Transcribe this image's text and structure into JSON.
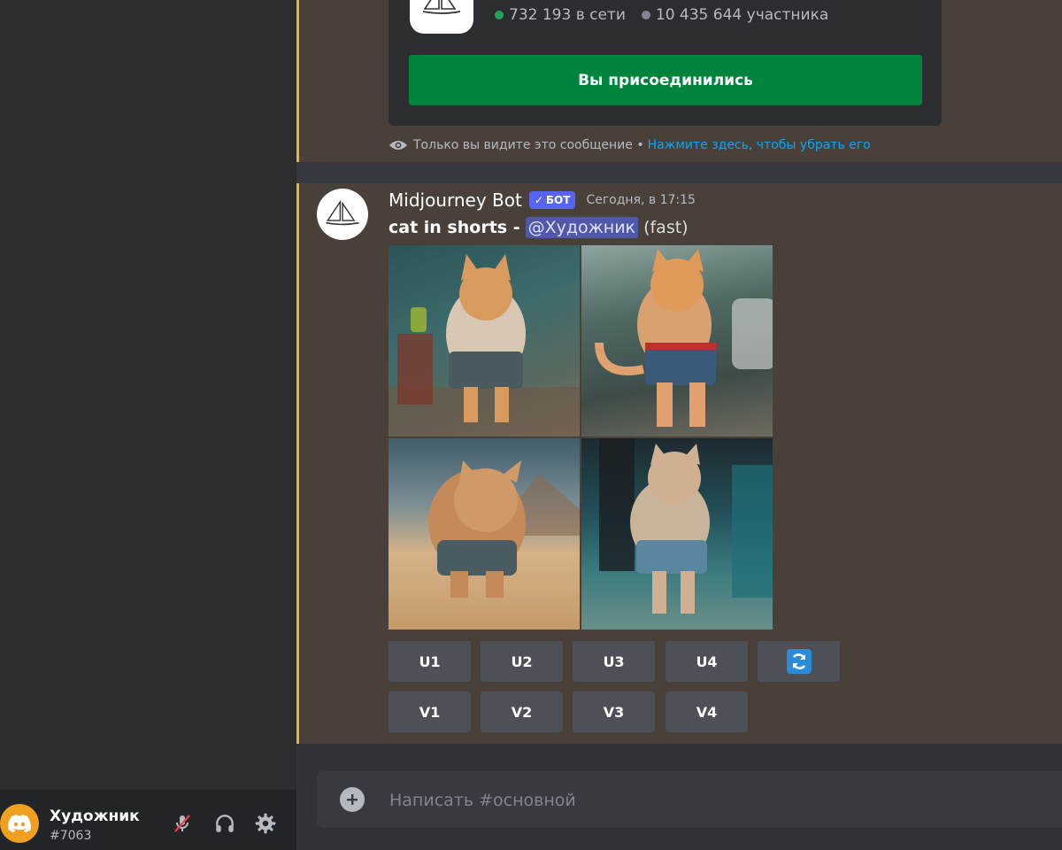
{
  "user": {
    "name": "Художник",
    "tag": "#7063"
  },
  "embed": {
    "online": "732 193 в сети",
    "members": "10 435 644 участника",
    "join_label": "Вы присоединились"
  },
  "ephemeral": {
    "notice": "Только вы видите это сообщение •",
    "dismiss_link": "Нажмите здесь, чтобы убрать его"
  },
  "message": {
    "author": "Midjourney Bot",
    "badge": "БОТ",
    "timestamp": "Сегодня, в 17:15",
    "prompt": "cat in shorts -",
    "mention": "@Художник",
    "mode": "(fast)"
  },
  "buttons": {
    "upscale": [
      "U1",
      "U2",
      "U3",
      "U4"
    ],
    "variation": [
      "V1",
      "V2",
      "V3",
      "V4"
    ]
  },
  "input": {
    "placeholder": "Написать #основной"
  },
  "colors": {
    "accent_highlight": "#f0b232",
    "join_green": "#00843d",
    "bot_badge": "#5865f2",
    "link": "#00a8fc",
    "online_green": "#23a559"
  }
}
